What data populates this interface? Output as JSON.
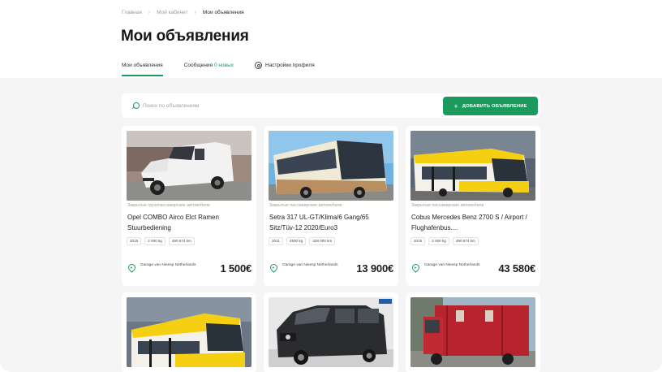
{
  "breadcrumb": {
    "home": "Главная",
    "cabinet": "Мой кабинет",
    "current": "Мои объявления"
  },
  "page_title": "Мои объявления",
  "tabs": [
    {
      "label": "Мои объявления",
      "badge": ""
    },
    {
      "label": "Сообщения",
      "badge": "0 новых"
    },
    {
      "label": "Настройки профиля",
      "badge": ""
    }
  ],
  "search": {
    "placeholder": "Поиск по объявлениям"
  },
  "add_button": {
    "label": "ДОБАВИТЬ ОБЪЯВЛЕНИЕ",
    "icon": "plus-icon"
  },
  "accent_color": "#1e9a5c",
  "listings": [
    {
      "category": "Закрытые грузопассажирские автомобили",
      "title": "Opel COMBO Airco Elct Ramen Stuurbediening",
      "tags": [
        "2015",
        "2 000 kg",
        "490 574 km"
      ],
      "location": "Garage van Nieesp Netherlands",
      "price": "1 500€",
      "image": "white-van-photo"
    },
    {
      "category": "Закрытые пассажирские автомобили",
      "title": "Setra 317 UL-GT/Klima/6 Gang/65 Sitz/Tüv-12 2020/Euro3",
      "tags": [
        "2011",
        "4500 kg",
        "328 000 km"
      ],
      "location": "Garage van Nieesp Netherlands",
      "price": "13 900€",
      "image": "coach-bus-photo"
    },
    {
      "category": "Закрытые пассажирские автомобили",
      "title": "Cobus Mercedes Benz 2700 S / Airport / Flughafenbus....",
      "tags": [
        "2015",
        "2 000 kg",
        "490 574 km"
      ],
      "location": "Garage van Nieesp Netherlands",
      "price": "43 580€",
      "image": "airport-bus-photo"
    },
    {
      "image": "airport-bus-photo-2"
    },
    {
      "image": "black-van-photo"
    },
    {
      "image": "red-truck-photo"
    }
  ]
}
